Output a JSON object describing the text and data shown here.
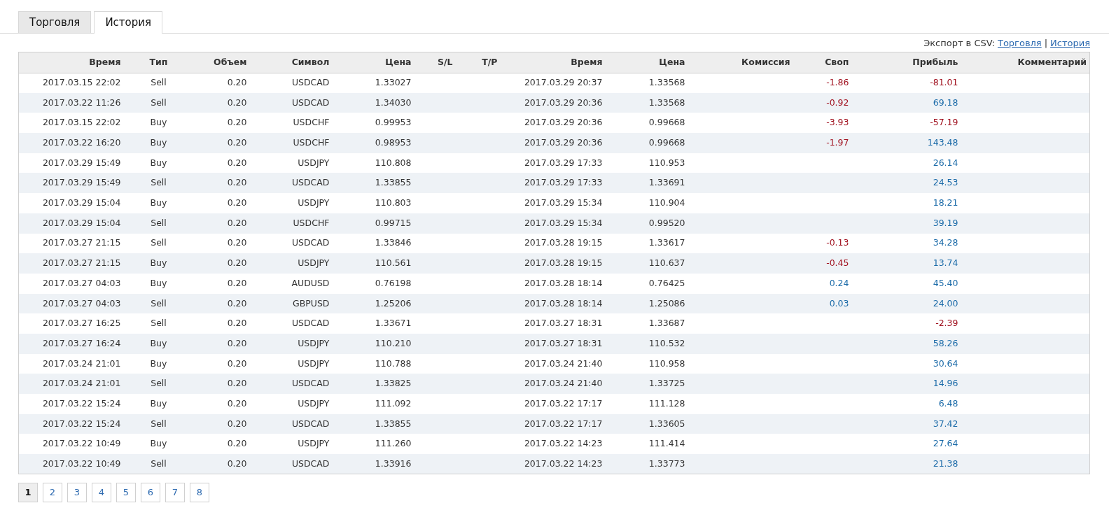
{
  "tabs": [
    {
      "label": "Торговля",
      "selected": false
    },
    {
      "label": "История",
      "selected": true
    }
  ],
  "export": {
    "label": "Экспорт в CSV:",
    "links": [
      "Торговля",
      "История"
    ],
    "separator": "|"
  },
  "table": {
    "columns": [
      "Время",
      "Тип",
      "Объем",
      "Символ",
      "Цена",
      "S/L",
      "T/P",
      "Время",
      "Цена",
      "Комиссия",
      "Своп",
      "Прибыль",
      "Комментарий"
    ],
    "rows": [
      {
        "cells": [
          "2017.03.15 22:02",
          "Sell",
          "0.20",
          "USDCAD",
          "1.33027",
          "",
          "",
          "2017.03.29 20:37",
          "1.33568",
          ""
        ],
        "swap": {
          "text": "-1.86",
          "color": "#a0101e"
        },
        "profit": {
          "text": "-81.01",
          "color": "#a0101e"
        }
      },
      {
        "cells": [
          "2017.03.22 11:26",
          "Sell",
          "0.20",
          "USDCAD",
          "1.34030",
          "",
          "",
          "2017.03.29 20:36",
          "1.33568",
          ""
        ],
        "swap": {
          "text": "-0.92",
          "color": "#a0101e"
        },
        "profit": {
          "text": "69.18",
          "color": "#1a6aa8"
        }
      },
      {
        "cells": [
          "2017.03.15 22:02",
          "Buy",
          "0.20",
          "USDCHF",
          "0.99953",
          "",
          "",
          "2017.03.29 20:36",
          "0.99668",
          ""
        ],
        "swap": {
          "text": "-3.93",
          "color": "#a0101e"
        },
        "profit": {
          "text": "-57.19",
          "color": "#a0101e"
        }
      },
      {
        "cells": [
          "2017.03.22 16:20",
          "Buy",
          "0.20",
          "USDCHF",
          "0.98953",
          "",
          "",
          "2017.03.29 20:36",
          "0.99668",
          ""
        ],
        "swap": {
          "text": "-1.97",
          "color": "#a0101e"
        },
        "profit": {
          "text": "143.48",
          "color": "#1a6aa8"
        }
      },
      {
        "cells": [
          "2017.03.29 15:49",
          "Buy",
          "0.20",
          "USDJPY",
          "110.808",
          "",
          "",
          "2017.03.29 17:33",
          "110.953",
          ""
        ],
        "profit": {
          "text": "26.14",
          "color": "#1a6aa8"
        }
      },
      {
        "cells": [
          "2017.03.29 15:49",
          "Sell",
          "0.20",
          "USDCAD",
          "1.33855",
          "",
          "",
          "2017.03.29 17:33",
          "1.33691",
          ""
        ],
        "profit": {
          "text": "24.53",
          "color": "#1a6aa8"
        }
      },
      {
        "cells": [
          "2017.03.29 15:04",
          "Buy",
          "0.20",
          "USDJPY",
          "110.803",
          "",
          "",
          "2017.03.29 15:34",
          "110.904",
          ""
        ],
        "profit": {
          "text": "18.21",
          "color": "#1a6aa8"
        }
      },
      {
        "cells": [
          "2017.03.29 15:04",
          "Sell",
          "0.20",
          "USDCHF",
          "0.99715",
          "",
          "",
          "2017.03.29 15:34",
          "0.99520",
          ""
        ],
        "profit": {
          "text": "39.19",
          "color": "#1a6aa8"
        }
      },
      {
        "cells": [
          "2017.03.27 21:15",
          "Sell",
          "0.20",
          "USDCAD",
          "1.33846",
          "",
          "",
          "2017.03.28 19:15",
          "1.33617",
          ""
        ],
        "swap": {
          "text": "-0.13",
          "color": "#a0101e"
        },
        "profit": {
          "text": "34.28",
          "color": "#1a6aa8"
        }
      },
      {
        "cells": [
          "2017.03.27 21:15",
          "Buy",
          "0.20",
          "USDJPY",
          "110.561",
          "",
          "",
          "2017.03.28 19:15",
          "110.637",
          ""
        ],
        "swap": {
          "text": "-0.45",
          "color": "#a0101e"
        },
        "profit": {
          "text": "13.74",
          "color": "#1a6aa8"
        }
      },
      {
        "cells": [
          "2017.03.27 04:03",
          "Buy",
          "0.20",
          "AUDUSD",
          "0.76198",
          "",
          "",
          "2017.03.28 18:14",
          "0.76425",
          ""
        ],
        "swap": {
          "text": "0.24",
          "color": "#1a6aa8"
        },
        "profit": {
          "text": "45.40",
          "color": "#1a6aa8"
        }
      },
      {
        "cells": [
          "2017.03.27 04:03",
          "Sell",
          "0.20",
          "GBPUSD",
          "1.25206",
          "",
          "",
          "2017.03.28 18:14",
          "1.25086",
          ""
        ],
        "swap": {
          "text": "0.03",
          "color": "#1a6aa8"
        },
        "profit": {
          "text": "24.00",
          "color": "#1a6aa8"
        }
      },
      {
        "cells": [
          "2017.03.27 16:25",
          "Sell",
          "0.20",
          "USDCAD",
          "1.33671",
          "",
          "",
          "2017.03.27 18:31",
          "1.33687",
          ""
        ],
        "profit": {
          "text": "-2.39",
          "color": "#a0101e"
        }
      },
      {
        "cells": [
          "2017.03.27 16:24",
          "Buy",
          "0.20",
          "USDJPY",
          "110.210",
          "",
          "",
          "2017.03.27 18:31",
          "110.532",
          ""
        ],
        "profit": {
          "text": "58.26",
          "color": "#1a6aa8"
        }
      },
      {
        "cells": [
          "2017.03.24 21:01",
          "Buy",
          "0.20",
          "USDJPY",
          "110.788",
          "",
          "",
          "2017.03.24 21:40",
          "110.958",
          ""
        ],
        "profit": {
          "text": "30.64",
          "color": "#1a6aa8"
        }
      },
      {
        "cells": [
          "2017.03.24 21:01",
          "Sell",
          "0.20",
          "USDCAD",
          "1.33825",
          "",
          "",
          "2017.03.24 21:40",
          "1.33725",
          ""
        ],
        "profit": {
          "text": "14.96",
          "color": "#1a6aa8"
        }
      },
      {
        "cells": [
          "2017.03.22 15:24",
          "Buy",
          "0.20",
          "USDJPY",
          "111.092",
          "",
          "",
          "2017.03.22 17:17",
          "111.128",
          ""
        ],
        "profit": {
          "text": "6.48",
          "color": "#1a6aa8"
        }
      },
      {
        "cells": [
          "2017.03.22 15:24",
          "Sell",
          "0.20",
          "USDCAD",
          "1.33855",
          "",
          "",
          "2017.03.22 17:17",
          "1.33605",
          ""
        ],
        "profit": {
          "text": "37.42",
          "color": "#1a6aa8"
        }
      },
      {
        "cells": [
          "2017.03.22 10:49",
          "Buy",
          "0.20",
          "USDJPY",
          "111.260",
          "",
          "",
          "2017.03.22 14:23",
          "111.414",
          ""
        ],
        "profit": {
          "text": "27.64",
          "color": "#1a6aa8"
        }
      },
      {
        "cells": [
          "2017.03.22 10:49",
          "Sell",
          "0.20",
          "USDCAD",
          "1.33916",
          "",
          "",
          "2017.03.22 14:23",
          "1.33773",
          ""
        ],
        "profit": {
          "text": "21.38",
          "color": "#1a6aa8"
        }
      }
    ]
  },
  "pagination": [
    {
      "label": "1",
      "selected": true
    },
    {
      "label": "2",
      "selected": false
    },
    {
      "label": "3",
      "selected": false
    },
    {
      "label": "4",
      "selected": false
    },
    {
      "label": "5",
      "selected": false
    },
    {
      "label": "6",
      "selected": false
    },
    {
      "label": "7",
      "selected": false
    },
    {
      "label": "8",
      "selected": false
    }
  ]
}
